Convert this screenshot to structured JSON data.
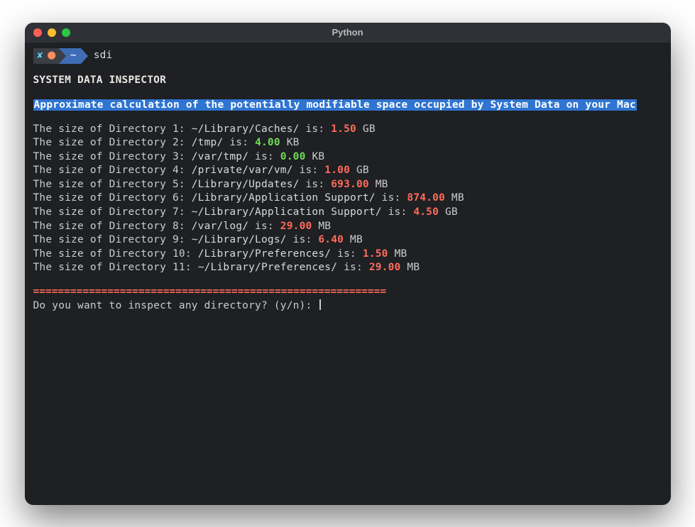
{
  "window": {
    "title": "Python"
  },
  "prompt": {
    "cwd": "~",
    "command": "sdi"
  },
  "heading": "SYSTEM DATA INSPECTOR",
  "subheading": "Approximate calculation of the potentially modifiable space occupied by System Data on your Mac",
  "dirs": [
    {
      "n": 1,
      "path": "~/Library/Caches/",
      "size": "1.50",
      "unit": "GB",
      "color": "red"
    },
    {
      "n": 2,
      "path": "/tmp/",
      "size": "4.00",
      "unit": "KB",
      "color": "green"
    },
    {
      "n": 3,
      "path": "/var/tmp/",
      "size": "0.00",
      "unit": "KB",
      "color": "green"
    },
    {
      "n": 4,
      "path": "/private/var/vm/",
      "size": "1.00",
      "unit": "GB",
      "color": "red"
    },
    {
      "n": 5,
      "path": "/Library/Updates/",
      "size": "693.00",
      "unit": "MB",
      "color": "red"
    },
    {
      "n": 6,
      "path": "/Library/Application Support/",
      "size": "874.00",
      "unit": "MB",
      "color": "red"
    },
    {
      "n": 7,
      "path": "~/Library/Application Support/",
      "size": "4.50",
      "unit": "GB",
      "color": "red"
    },
    {
      "n": 8,
      "path": "/var/log/",
      "size": "29.00",
      "unit": "MB",
      "color": "red"
    },
    {
      "n": 9,
      "path": "~/Library/Logs/",
      "size": "6.40",
      "unit": "MB",
      "color": "red"
    },
    {
      "n": 10,
      "path": "/Library/Preferences/",
      "size": "1.50",
      "unit": "MB",
      "color": "red"
    },
    {
      "n": 11,
      "path": "~/Library/Preferences/",
      "size": "29.00",
      "unit": "MB",
      "color": "red"
    }
  ],
  "separator": "=========================================================",
  "question": "Do you want to inspect any directory? (y/n): "
}
